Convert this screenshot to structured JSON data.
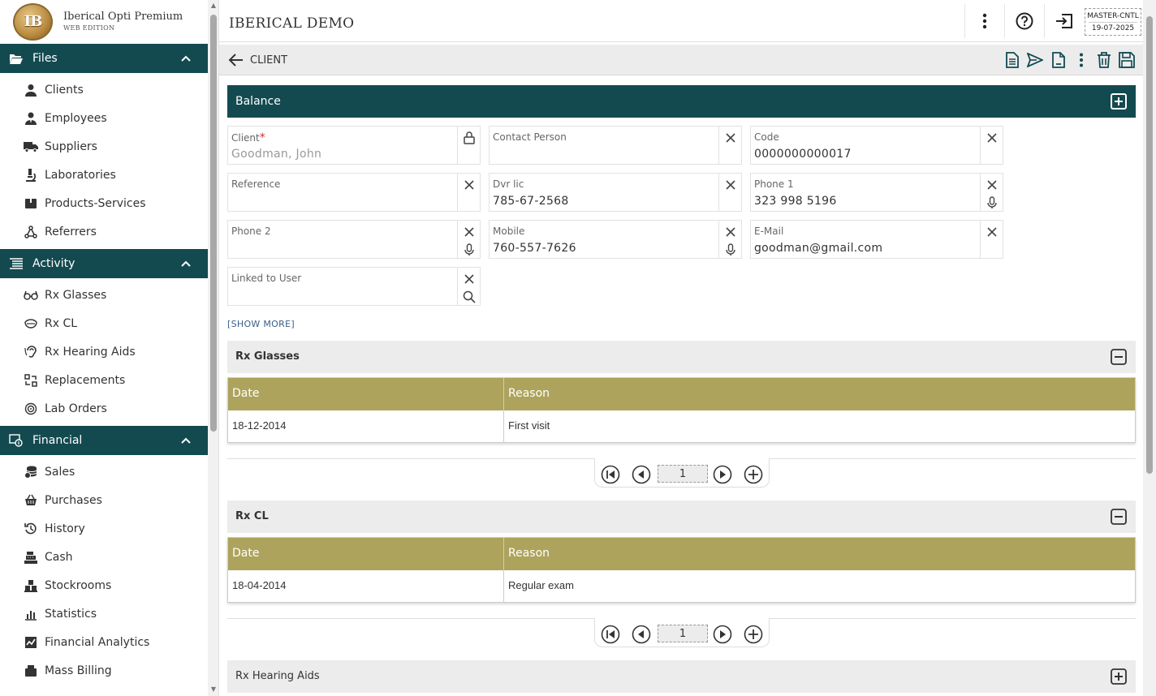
{
  "app": {
    "name": "Iberical Opti Premium",
    "edition": "WEB EDITION",
    "logo_text": "IB"
  },
  "sidebar": {
    "sections": [
      {
        "title": "Files",
        "icon": "folder-open-icon",
        "items": [
          {
            "label": "Clients",
            "icon": "person-icon"
          },
          {
            "label": "Employees",
            "icon": "employee-icon"
          },
          {
            "label": "Suppliers",
            "icon": "truck-icon"
          },
          {
            "label": "Laboratories",
            "icon": "microscope-icon"
          },
          {
            "label": "Products-Services",
            "icon": "box-icon"
          },
          {
            "label": "Referrers",
            "icon": "network-icon"
          }
        ]
      },
      {
        "title": "Activity",
        "icon": "list-icon",
        "items": [
          {
            "label": "Rx Glasses",
            "icon": "glasses-icon"
          },
          {
            "label": "Rx CL",
            "icon": "contact-lens-icon"
          },
          {
            "label": "Rx Hearing Aids",
            "icon": "ear-icon"
          },
          {
            "label": "Replacements",
            "icon": "replace-icon"
          },
          {
            "label": "Lab Orders",
            "icon": "lab-order-icon"
          }
        ]
      },
      {
        "title": "Financial",
        "icon": "money-icon",
        "items": [
          {
            "label": "Sales",
            "icon": "coins-icon"
          },
          {
            "label": "Purchases",
            "icon": "basket-icon"
          },
          {
            "label": "History",
            "icon": "history-icon"
          },
          {
            "label": "Cash",
            "icon": "cash-register-icon"
          },
          {
            "label": "Stockrooms",
            "icon": "boxes-icon"
          },
          {
            "label": "Statistics",
            "icon": "bar-chart-icon"
          },
          {
            "label": "Financial Analytics",
            "icon": "analytics-icon"
          },
          {
            "label": "Mass Billing",
            "icon": "billing-icon"
          }
        ]
      }
    ]
  },
  "topbar": {
    "company": "IBERICAL DEMO",
    "user": "MASTER-CNTL",
    "date": "19-07-2025"
  },
  "page": {
    "title": "CLIENT",
    "balance_label": "Balance",
    "show_more": "[SHOW MORE]",
    "fields": {
      "client": {
        "label": "Client",
        "required": "*",
        "value": "Goodman, John"
      },
      "contact_person": {
        "label": "Contact Person",
        "value": ""
      },
      "code": {
        "label": "Code",
        "value": "0000000000017"
      },
      "reference": {
        "label": "Reference",
        "value": ""
      },
      "dvr_lic": {
        "label": "Dvr lic",
        "value": "785-67-2568"
      },
      "phone1": {
        "label": "Phone 1",
        "value": "323 998 5196"
      },
      "phone2": {
        "label": "Phone 2",
        "value": ""
      },
      "mobile": {
        "label": "Mobile",
        "value": "760-557-7626"
      },
      "email": {
        "label": "E-Mail",
        "value": "goodman@gmail.com"
      },
      "linked_user": {
        "label": "Linked to User",
        "value": ""
      }
    },
    "rx_glasses": {
      "title": "Rx Glasses",
      "columns": [
        "Date",
        "Reason"
      ],
      "rows": [
        {
          "date": "18-12-2014",
          "reason": "First visit"
        }
      ],
      "page": "1"
    },
    "rx_cl": {
      "title": "Rx CL",
      "columns": [
        "Date",
        "Reason"
      ],
      "rows": [
        {
          "date": "18-04-2014",
          "reason": "Regular exam"
        }
      ],
      "page": "1"
    },
    "rx_hearing": {
      "title": "Rx Hearing Aids"
    }
  },
  "colors": {
    "primary": "#134a50",
    "grid_header": "#ada35c",
    "required": "#d32f2f"
  }
}
